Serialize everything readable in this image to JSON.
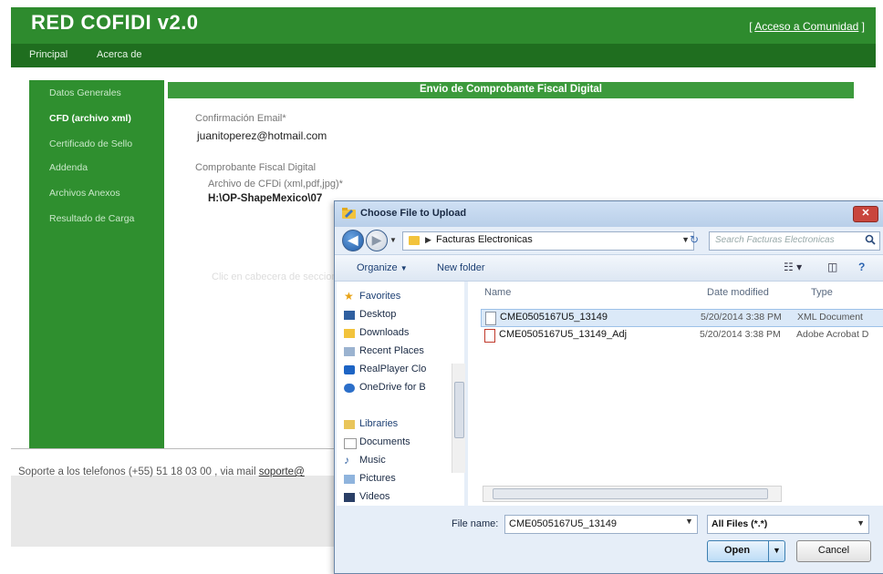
{
  "site": {
    "title": "RED COFIDI v2.0",
    "community_link": "Acceso a Comunidad",
    "nav": [
      "Principal",
      "Acerca de"
    ],
    "colors": {
      "header": "#2e8b2e",
      "nav": "#1f6e1f",
      "sidebar": "#2f8f2f"
    }
  },
  "sidebar": {
    "items": [
      {
        "label": "Datos Generales",
        "active": false
      },
      {
        "label": "CFD (archivo xml)",
        "active": true
      },
      {
        "label": "Certificado de Sello",
        "active": false
      },
      {
        "label": "Addenda",
        "active": false
      },
      {
        "label": "Archivos Anexos",
        "active": false
      },
      {
        "label": "Resultado de Carga",
        "active": false
      }
    ]
  },
  "form": {
    "title": "Envio de Comprobante Fiscal Digital",
    "email_label": "Confirmación Email*",
    "email_value": "juanitoperez@hotmail.com",
    "section_label": "Comprobante Fiscal Digital",
    "file_label": "Archivo de CFDi (xml,pdf,jpg)*",
    "file_path": "H:\\OP-ShapeMexico\\07",
    "faded_text": "Clic en cabecera de seccion"
  },
  "footer": {
    "text": "Soporte a los telefonos (+55) 51 18 03 00 , via mail",
    "mail": "soporte@"
  },
  "dialog": {
    "title": "Choose File to Upload",
    "close_icon": "close-icon",
    "address": "Facturas Electronicas",
    "search_placeholder": "Search Facturas Electronicas",
    "toolbar": {
      "organize": "Organize",
      "new_folder": "New folder"
    },
    "nav": {
      "favorites_header": "Favorites",
      "favorites": [
        "Desktop",
        "Downloads",
        "Recent Places",
        "RealPlayer Clo",
        "OneDrive for B"
      ],
      "libraries_header": "Libraries",
      "libraries": [
        "Documents",
        "Music",
        "Pictures",
        "Videos"
      ]
    },
    "columns": [
      "Name",
      "Date modified",
      "Type"
    ],
    "files": [
      {
        "name": "CME0505167U5_13149",
        "date": "5/20/2014 3:38 PM",
        "type": "XML Document",
        "icon": "xml-file-icon",
        "selected": true
      },
      {
        "name": "CME0505167U5_13149_Adj",
        "date": "5/20/2014 3:38 PM",
        "type": "Adobe Acrobat D",
        "icon": "pdf-file-icon",
        "selected": false
      }
    ],
    "filename_label": "File name:",
    "filename_value": "CME0505167U5_13149",
    "filter": "All Files (*.*)",
    "open_label": "Open",
    "cancel_label": "Cancel"
  }
}
